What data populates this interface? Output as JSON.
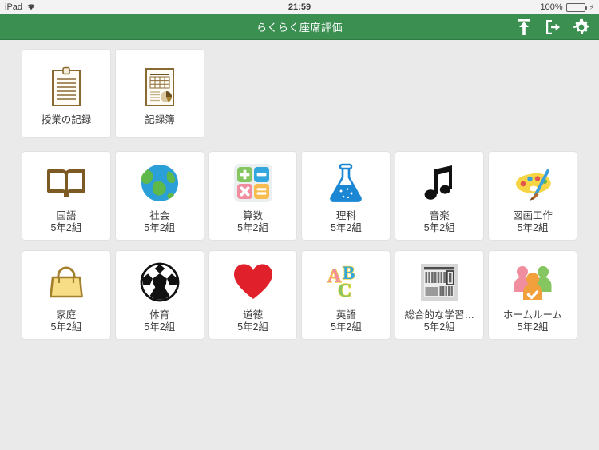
{
  "status_bar": {
    "device": "iPad",
    "wifi_icon": "wifi-icon",
    "time": "21:59",
    "battery_percent": "100%",
    "battery_icon": "battery-icon",
    "charging_icon": "charging-bolt-icon"
  },
  "nav": {
    "title": "らくらく座席評価",
    "actions": [
      {
        "name": "upload-export-icon",
        "label": "アップロード"
      },
      {
        "name": "logout-icon",
        "label": "ログアウト"
      },
      {
        "name": "gear-icon",
        "label": "設定"
      }
    ]
  },
  "colors": {
    "nav_green": "#3a8f51",
    "page_background": "#eaeaea",
    "tile_background": "#ffffff",
    "label_text": "#3a3a3a",
    "brown": "#8a6a33",
    "blue": "#1b87d4",
    "red": "#e0212b",
    "orange": "#f2a03c"
  },
  "rows": [
    {
      "name": "records-row",
      "tiles": [
        {
          "icon": "lesson-record-icon",
          "label": "授業の記録",
          "sub": ""
        },
        {
          "icon": "record-book-icon",
          "label": "記録簿",
          "sub": ""
        }
      ]
    },
    {
      "name": "subjects-row-1",
      "tiles": [
        {
          "icon": "open-book-icon",
          "label": "国語",
          "sub": "5年2組"
        },
        {
          "icon": "globe-icon",
          "label": "社会",
          "sub": "5年2組"
        },
        {
          "icon": "calculator-icon",
          "label": "算数",
          "sub": "5年2組"
        },
        {
          "icon": "flask-icon",
          "label": "理科",
          "sub": "5年2組"
        },
        {
          "icon": "music-note-icon",
          "label": "音楽",
          "sub": "5年2組"
        },
        {
          "icon": "palette-icon",
          "label": "図画工作",
          "sub": "5年2組"
        }
      ]
    },
    {
      "name": "subjects-row-2",
      "tiles": [
        {
          "icon": "handbag-icon",
          "label": "家庭",
          "sub": "5年2組"
        },
        {
          "icon": "soccer-ball-icon",
          "label": "体育",
          "sub": "5年2組"
        },
        {
          "icon": "heart-icon",
          "label": "道徳",
          "sub": "5年2組"
        },
        {
          "icon": "abc-letters-icon",
          "label": "英語",
          "sub": "5年2組"
        },
        {
          "icon": "bookshelf-icon",
          "label": "総合的な学習…",
          "sub": "5年2組"
        },
        {
          "icon": "people-group-icon",
          "label": "ホームルーム",
          "sub": "5年2組"
        }
      ]
    }
  ]
}
